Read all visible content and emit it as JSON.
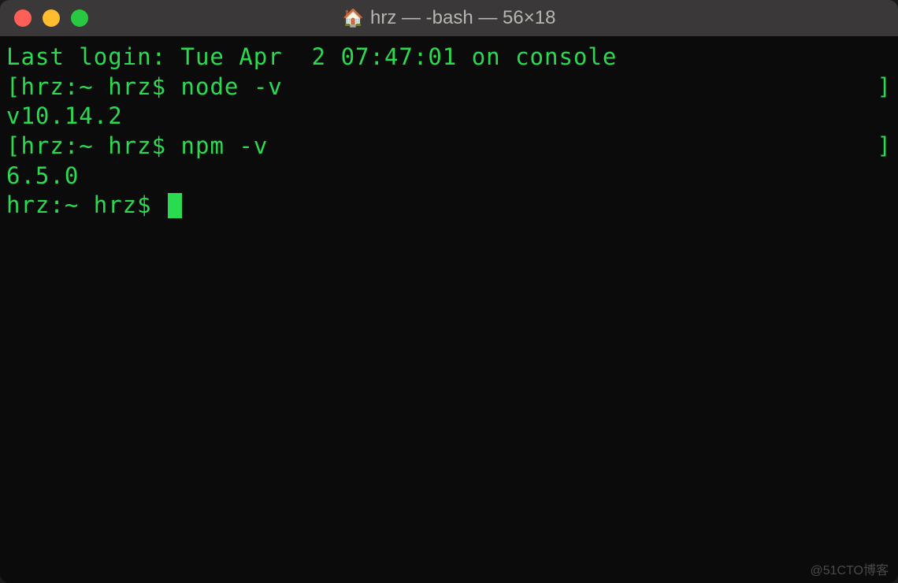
{
  "titlebar": {
    "title": "hrz — -bash — 56×18",
    "home_icon": "🏠"
  },
  "terminal": {
    "last_login": "Last login: Tue Apr  2 07:47:01 on console",
    "bracket_l": "[",
    "bracket_r": "]",
    "lines": [
      {
        "prompt": "hrz:~ hrz$ ",
        "cmd": "node -v"
      },
      {
        "output": "v10.14.2"
      },
      {
        "prompt": "hrz:~ hrz$ ",
        "cmd": "npm -v"
      },
      {
        "output": "6.5.0"
      },
      {
        "prompt": "hrz:~ hrz$ ",
        "cmd": ""
      }
    ]
  },
  "watermark": "@51CTO博客"
}
